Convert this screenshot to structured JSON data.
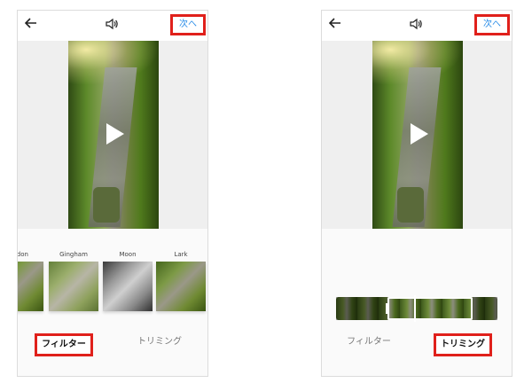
{
  "screens": {
    "left": {
      "next_label": "次へ",
      "filters": [
        {
          "name": "endon"
        },
        {
          "name": "Gingham"
        },
        {
          "name": "Moon"
        },
        {
          "name": "Lark"
        }
      ],
      "tabs": {
        "filter": "フィルター",
        "trim": "トリミング"
      },
      "active_tab": "filter"
    },
    "right": {
      "next_label": "次へ",
      "tabs": {
        "filter": "フィルター",
        "trim": "トリミング"
      },
      "active_tab": "trim"
    }
  },
  "icons": {
    "back": "arrow-left-icon",
    "sound": "speaker-icon",
    "play": "play-icon"
  },
  "colors": {
    "highlight": "#e0201b",
    "link": "#2c8ee8"
  }
}
